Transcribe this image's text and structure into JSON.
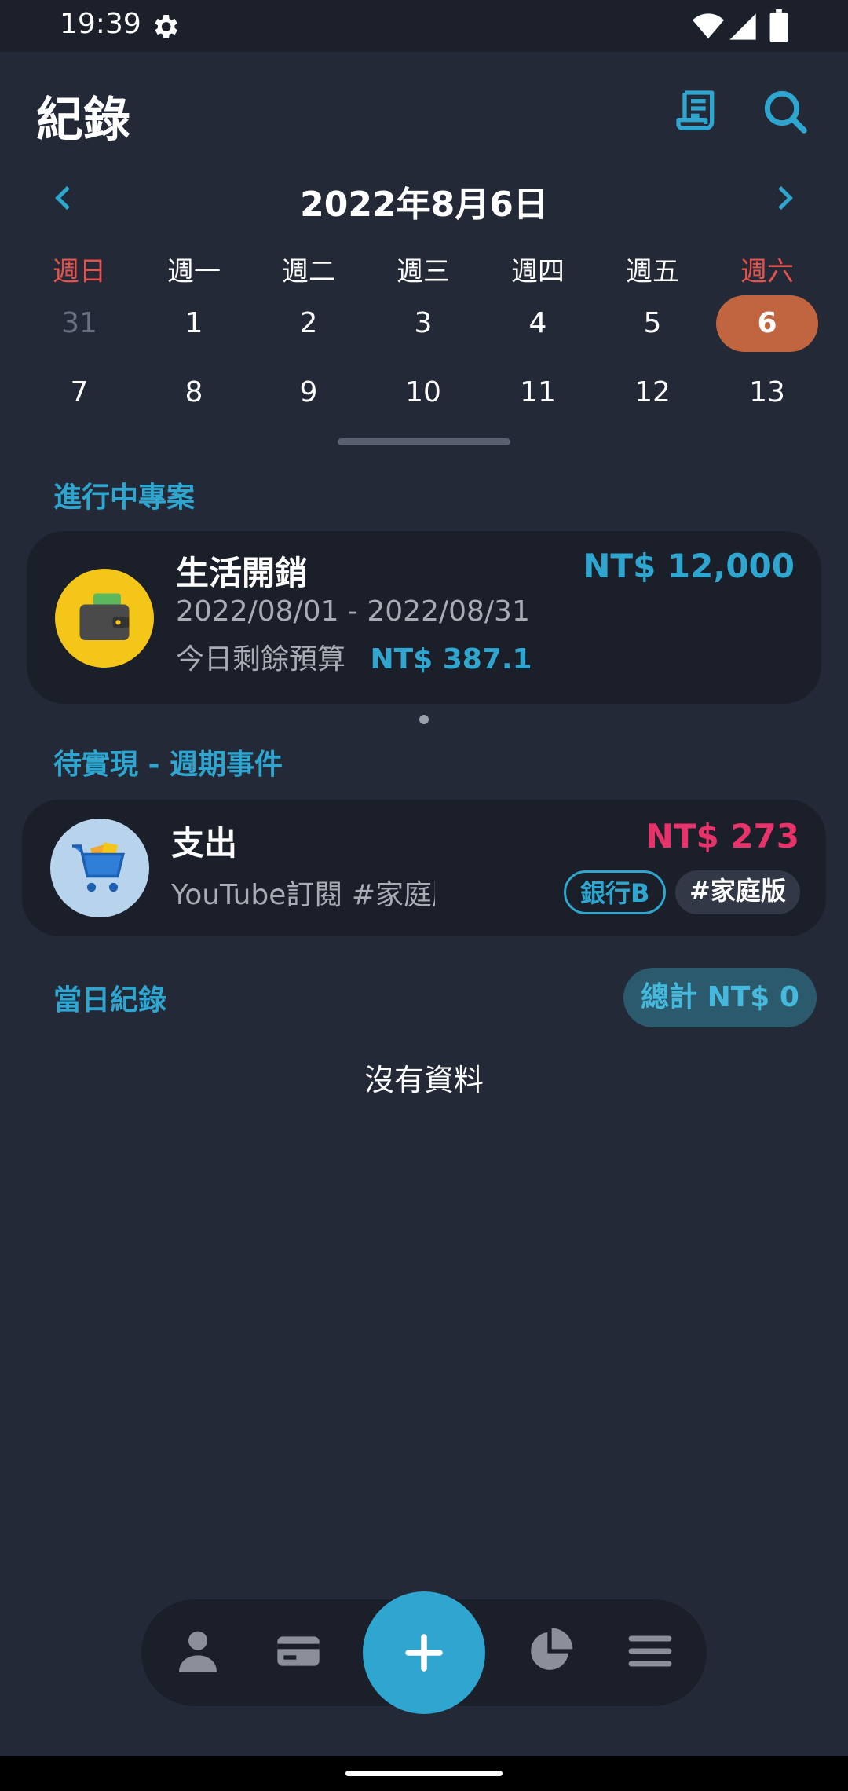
{
  "status_bar": {
    "time": "19:39"
  },
  "header": {
    "title": "紀錄"
  },
  "calendar": {
    "month_label": "2022年8月6日",
    "weekdays": [
      "週日",
      "週一",
      "週二",
      "週三",
      "週四",
      "週五",
      "週六"
    ],
    "week1": [
      "31",
      "1",
      "2",
      "3",
      "4",
      "5",
      "6"
    ],
    "week2": [
      "7",
      "8",
      "9",
      "10",
      "11",
      "12",
      "13"
    ]
  },
  "projects": {
    "section_label": "進行中專案",
    "card": {
      "name": "生活開銷",
      "amount": "NT$ 12,000",
      "date_range": "2022/08/01 - 2022/08/31",
      "remaining_label": "今日剩餘預算",
      "remaining_value": "NT$ 387.1"
    }
  },
  "recurring": {
    "section_label": "待實現 - 週期事件",
    "card": {
      "type": "支出",
      "amount": "NT$ 273",
      "description": "YouTube訂閱 #家庭版",
      "tag_account": "銀行B",
      "tag_label": "#家庭版"
    }
  },
  "daily": {
    "section_label": "當日紀錄",
    "total": "總計 NT$ 0",
    "empty": "沒有資料"
  },
  "colors": {
    "background": "#242938",
    "card": "#1b1f29",
    "accent": "#2ea6cf",
    "expense": "#e8336a",
    "weekend": "#e8504a",
    "selected": "#c0653f"
  },
  "icons": {
    "status": [
      "gear-icon",
      "wifi-icon",
      "signal-icon",
      "battery-icon"
    ],
    "header": [
      "receipt-icon",
      "search-icon"
    ],
    "nav": [
      "person-icon",
      "card-icon",
      "add-icon",
      "pie-chart-icon",
      "list-icon"
    ]
  }
}
